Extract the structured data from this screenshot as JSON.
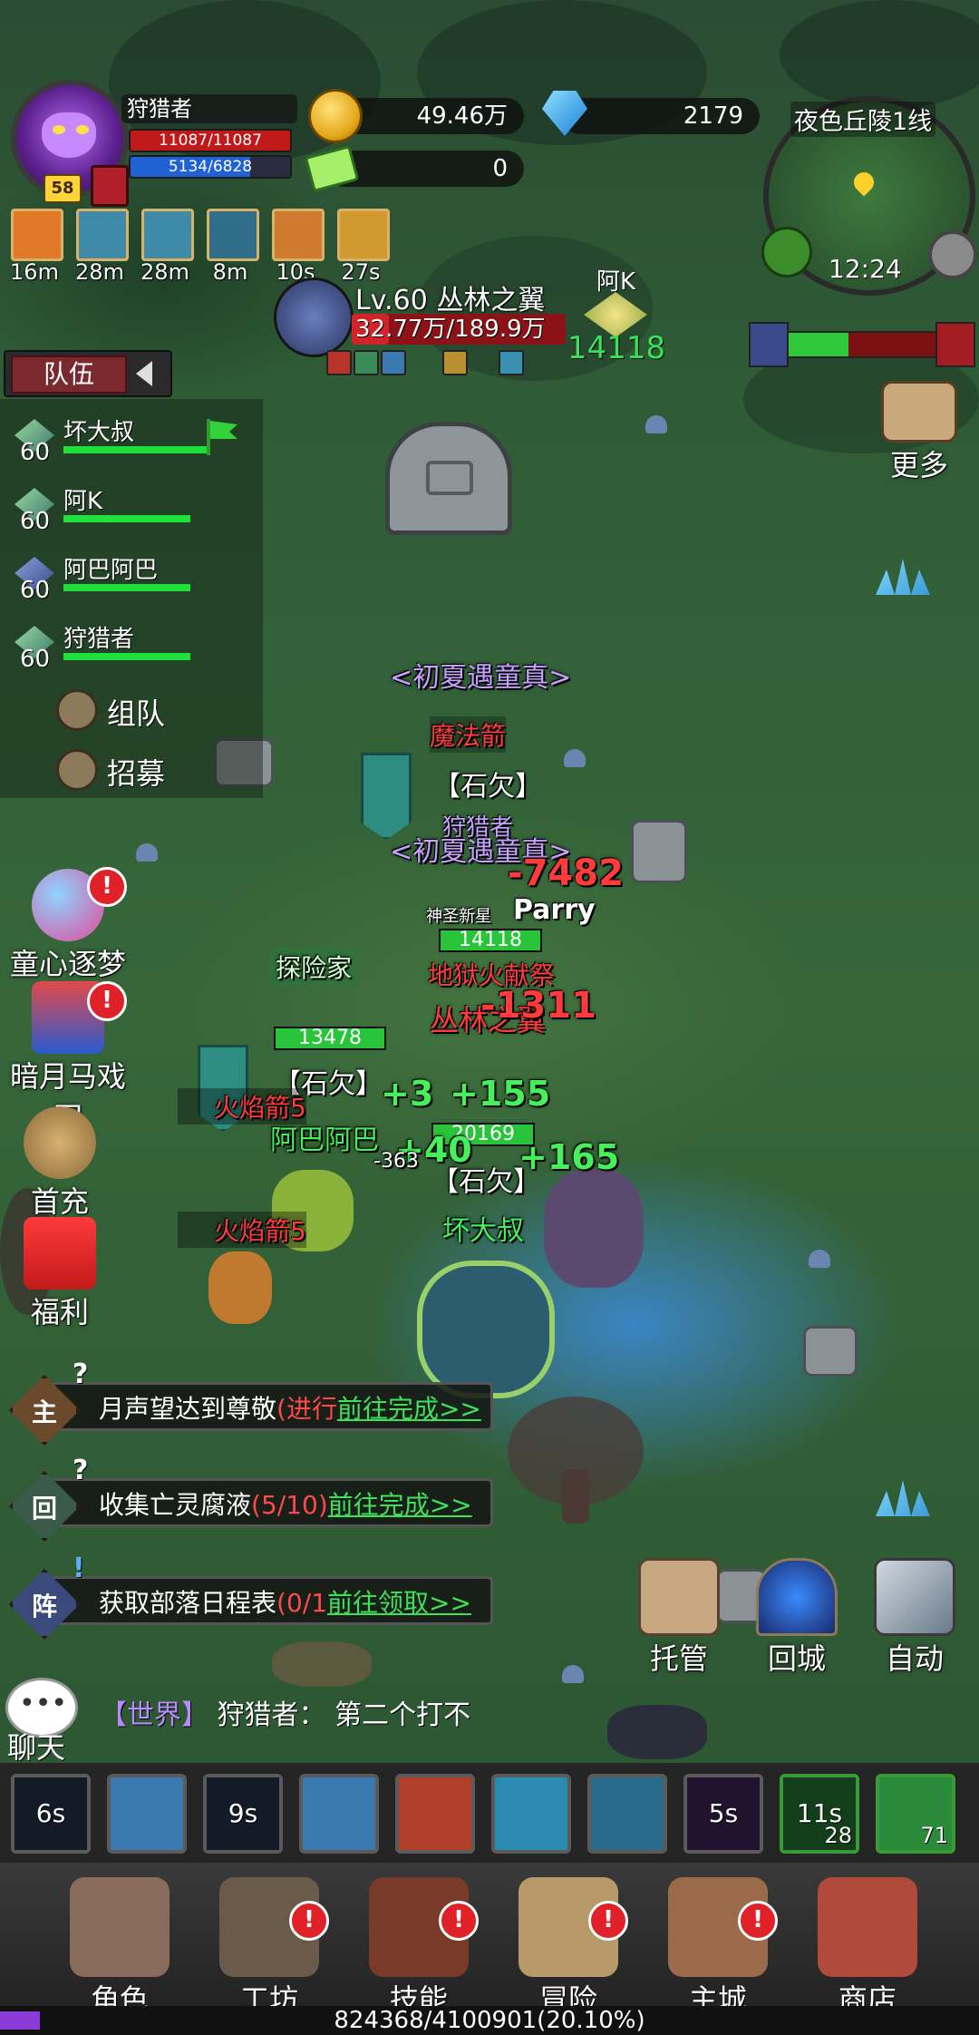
{
  "player": {
    "name": "狩猎者",
    "hp": "11087/11087",
    "mp": "5134/6828",
    "level": "58"
  },
  "currency": {
    "gold": "49.46万",
    "gems": "2179",
    "tickets": "0"
  },
  "buffs": [
    {
      "icon": "sunset-buff-icon",
      "time": "16m",
      "color": "#e07a2a"
    },
    {
      "icon": "shield-buff-icon",
      "time": "28m",
      "color": "#3e8aa8"
    },
    {
      "icon": "boots-buff-icon",
      "time": "28m",
      "color": "#3e8aa8"
    },
    {
      "icon": "wind-buff-icon",
      "time": "8m",
      "color": "#2f6e8a"
    },
    {
      "icon": "no-shield-buff-icon",
      "time": "10s",
      "color": "#d07a30"
    },
    {
      "icon": "golden-shield-buff-icon",
      "time": "27s",
      "color": "#d09a30"
    }
  ],
  "boss": {
    "name": "Lv.60 丛林之翼",
    "hp": "32.77万/189.9万",
    "hp_fraction": 0.173
  },
  "target": {
    "name": "阿K",
    "score": "14118"
  },
  "minimap": {
    "zone": "夜色丘陵1线",
    "time": "12:24"
  },
  "pvp": {
    "ally_fraction": 0.4
  },
  "more_label": "更多",
  "team": {
    "tab_label": "队伍",
    "members": [
      {
        "level": "60",
        "name": "坏大叔"
      },
      {
        "level": "60",
        "name": "阿K"
      },
      {
        "level": "60",
        "name": "阿巴阿巴"
      },
      {
        "level": "60",
        "name": "狩猎者"
      }
    ],
    "form_team": "组队",
    "recruit": "招募"
  },
  "events": [
    {
      "label": "童心逐梦",
      "badge": "!"
    },
    {
      "label": "暗月马戏团",
      "badge": "!"
    },
    {
      "label": "首充",
      "badge": ""
    },
    {
      "label": "福利",
      "badge": ""
    }
  ],
  "battle": {
    "guild1": "<初夏遇童真>",
    "spell1": "魔法箭",
    "shiqian1": "【石欠】",
    "hunter_label": "狩猎者",
    "guild2": "<初夏遇童真>",
    "dmg1": "-7482",
    "parry": "Parry",
    "shenshu": "神圣新星",
    "bar_14118": "14118",
    "explorer": "探险家",
    "hell_fire": "地狱火献祭",
    "jungle": "丛林之翼",
    "dmg2": "-1311",
    "bar_13478": "13478",
    "shiqian2": "【石欠】",
    "heal1": "+3",
    "heal2": "+155",
    "fire_arrow": "火焰箭5",
    "abababa": "阿巴阿巴",
    "bar_20169": "20169",
    "heal3": "+40",
    "heal4": "+165",
    "dmg3": "-363",
    "shiqian3": "【石欠】",
    "huaidashu": "坏大叔",
    "fire_arrow2": "火焰箭5"
  },
  "quests": [
    {
      "tag": "主",
      "text": "月声望达到尊敬",
      "progress": "(进行",
      "go": "前往完成>>"
    },
    {
      "tag": "回",
      "text": "收集亡灵腐液",
      "progress": "(5/10)",
      "go": "前往完成>>"
    },
    {
      "tag": "阵",
      "text": "获取部落日程表",
      "progress": "(0/1",
      "go": "前往领取>>"
    }
  ],
  "actions": {
    "auto_manage": "托管",
    "return_city": "回城",
    "auto": "自动"
  },
  "chat": {
    "label": "聊天",
    "channel": "【世界】",
    "sender": "狩猎者：",
    "message": "第二个打不"
  },
  "skills": [
    {
      "icon": "spear-skill-icon",
      "cd": "6s",
      "count": ""
    },
    {
      "icon": "arrow-skill-icon",
      "cd": "",
      "count": ""
    },
    {
      "icon": "crossbow-skill-icon",
      "cd": "9s",
      "count": ""
    },
    {
      "icon": "multishot-skill-icon",
      "cd": "",
      "count": ""
    },
    {
      "icon": "target-skill-icon",
      "cd": "",
      "count": ""
    },
    {
      "icon": "vortex-skill-icon",
      "cd": "",
      "count": ""
    },
    {
      "icon": "wind-skill-icon",
      "cd": "",
      "count": ""
    },
    {
      "icon": "purple-arrow-skill-icon",
      "cd": "5s",
      "count": ""
    },
    {
      "icon": "potion-skill-icon",
      "cd": "11s",
      "count": "28"
    },
    {
      "icon": "drink-skill-icon",
      "cd": "",
      "count": "71"
    }
  ],
  "nav": [
    {
      "label": "角色",
      "badge": ""
    },
    {
      "label": "工坊",
      "badge": "!"
    },
    {
      "label": "技能",
      "badge": "!"
    },
    {
      "label": "冒险",
      "badge": "!"
    },
    {
      "label": "主城",
      "badge": "!"
    },
    {
      "label": "商店",
      "badge": ""
    }
  ],
  "xp": {
    "text": "824368/4100901(20.10%)",
    "fraction": 0.201
  }
}
